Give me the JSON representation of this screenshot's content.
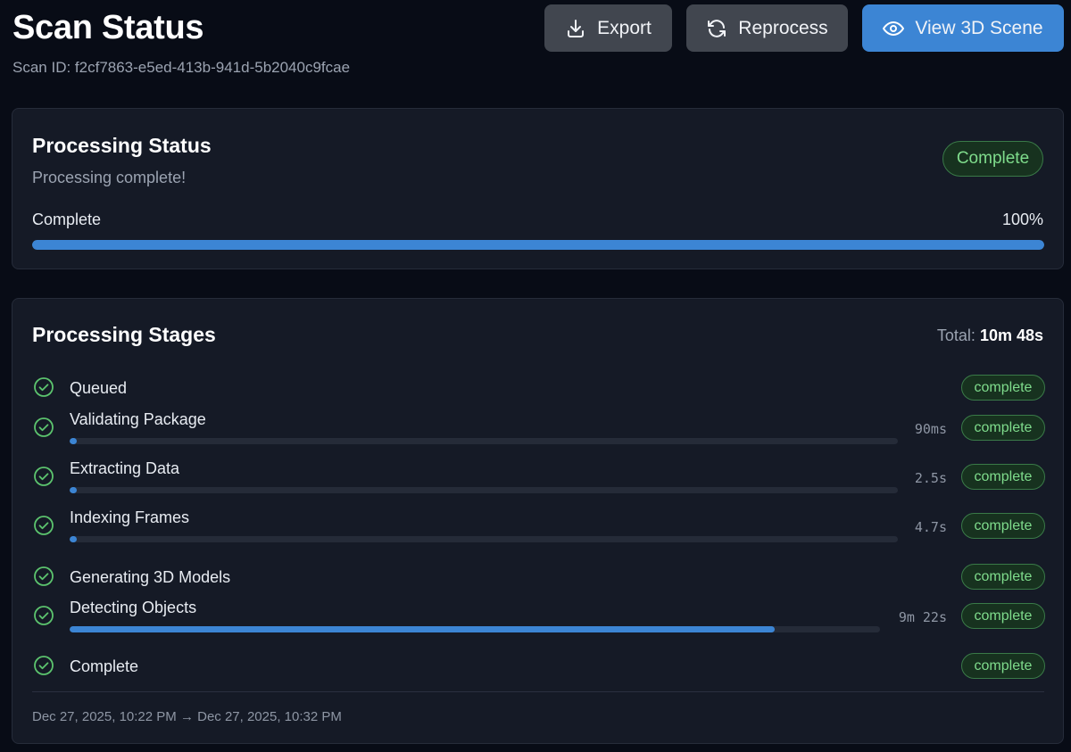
{
  "header": {
    "title": "Scan Status",
    "scan_id": "Scan ID: f2cf7863-e5ed-413b-941d-5b2040c9fcae",
    "buttons": {
      "export": "Export",
      "reprocess": "Reprocess",
      "view_3d": "View 3D Scene"
    }
  },
  "status_card": {
    "title": "Processing Status",
    "message": "Processing complete!",
    "badge": "Complete",
    "progress_label": "Complete",
    "progress_text": "100%",
    "progress_value": 1.0
  },
  "stages_card": {
    "title": "Processing Stages",
    "total_label": "Total:",
    "total_value": "10m 48s",
    "stages": [
      {
        "name": "Queued",
        "duration": "",
        "status": "complete",
        "progress": null
      },
      {
        "name": "Validating Package",
        "duration": "90ms",
        "status": "complete",
        "progress": 0.0
      },
      {
        "name": "Extracting Data",
        "duration": "2.5s",
        "status": "complete",
        "progress": 0.0
      },
      {
        "name": "Indexing Frames",
        "duration": "4.7s",
        "status": "complete",
        "progress": 0.0
      },
      {
        "name": "Generating 3D Models",
        "duration": "",
        "status": "complete",
        "progress": null
      },
      {
        "name": "Detecting Objects",
        "duration": "9m 22s",
        "status": "complete",
        "progress": 0.87
      },
      {
        "name": "Complete",
        "duration": "",
        "status": "complete",
        "progress": null
      }
    ],
    "time_range": "Dec 27, 2025, 10:22 PM → Dec 27, 2025, 10:32 PM"
  },
  "colors": {
    "accent": "#3c85d4",
    "success": "#7fdc8c",
    "background": "#080c16",
    "card": "#151a26"
  }
}
